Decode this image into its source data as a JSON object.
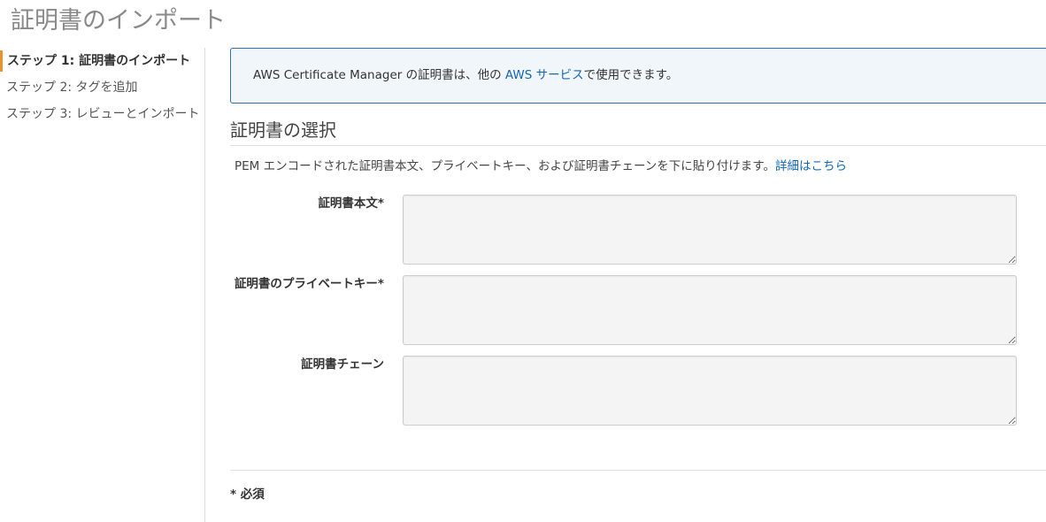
{
  "page": {
    "title": "証明書のインポート"
  },
  "sidebar": {
    "steps": [
      {
        "label": "ステップ 1: 証明書のインポート",
        "active": true
      },
      {
        "label": "ステップ 2: タグを追加",
        "active": false
      },
      {
        "label": "ステップ 3: レビューとインポート",
        "active": false
      }
    ]
  },
  "info": {
    "text_before": "AWS Certificate Manager の証明書は、他の ",
    "link": "AWS サービス",
    "text_after": "で使用できます。"
  },
  "section": {
    "title": "証明書の選択",
    "description": "PEM エンコードされた証明書本文、プライベートキー、および証明書チェーンを下に貼り付けます。",
    "more_link": "詳細はこちら"
  },
  "fields": {
    "body": {
      "label": "証明書本文*",
      "value": ""
    },
    "private_key": {
      "label": "証明書のプライベートキー*",
      "value": ""
    },
    "chain": {
      "label": "証明書チェーン",
      "value": ""
    }
  },
  "footer": {
    "required_note": "* 必須"
  },
  "colors": {
    "active_step_accent": "#ec912d",
    "link": "#1166bb",
    "info_border": "#2e73b8"
  }
}
